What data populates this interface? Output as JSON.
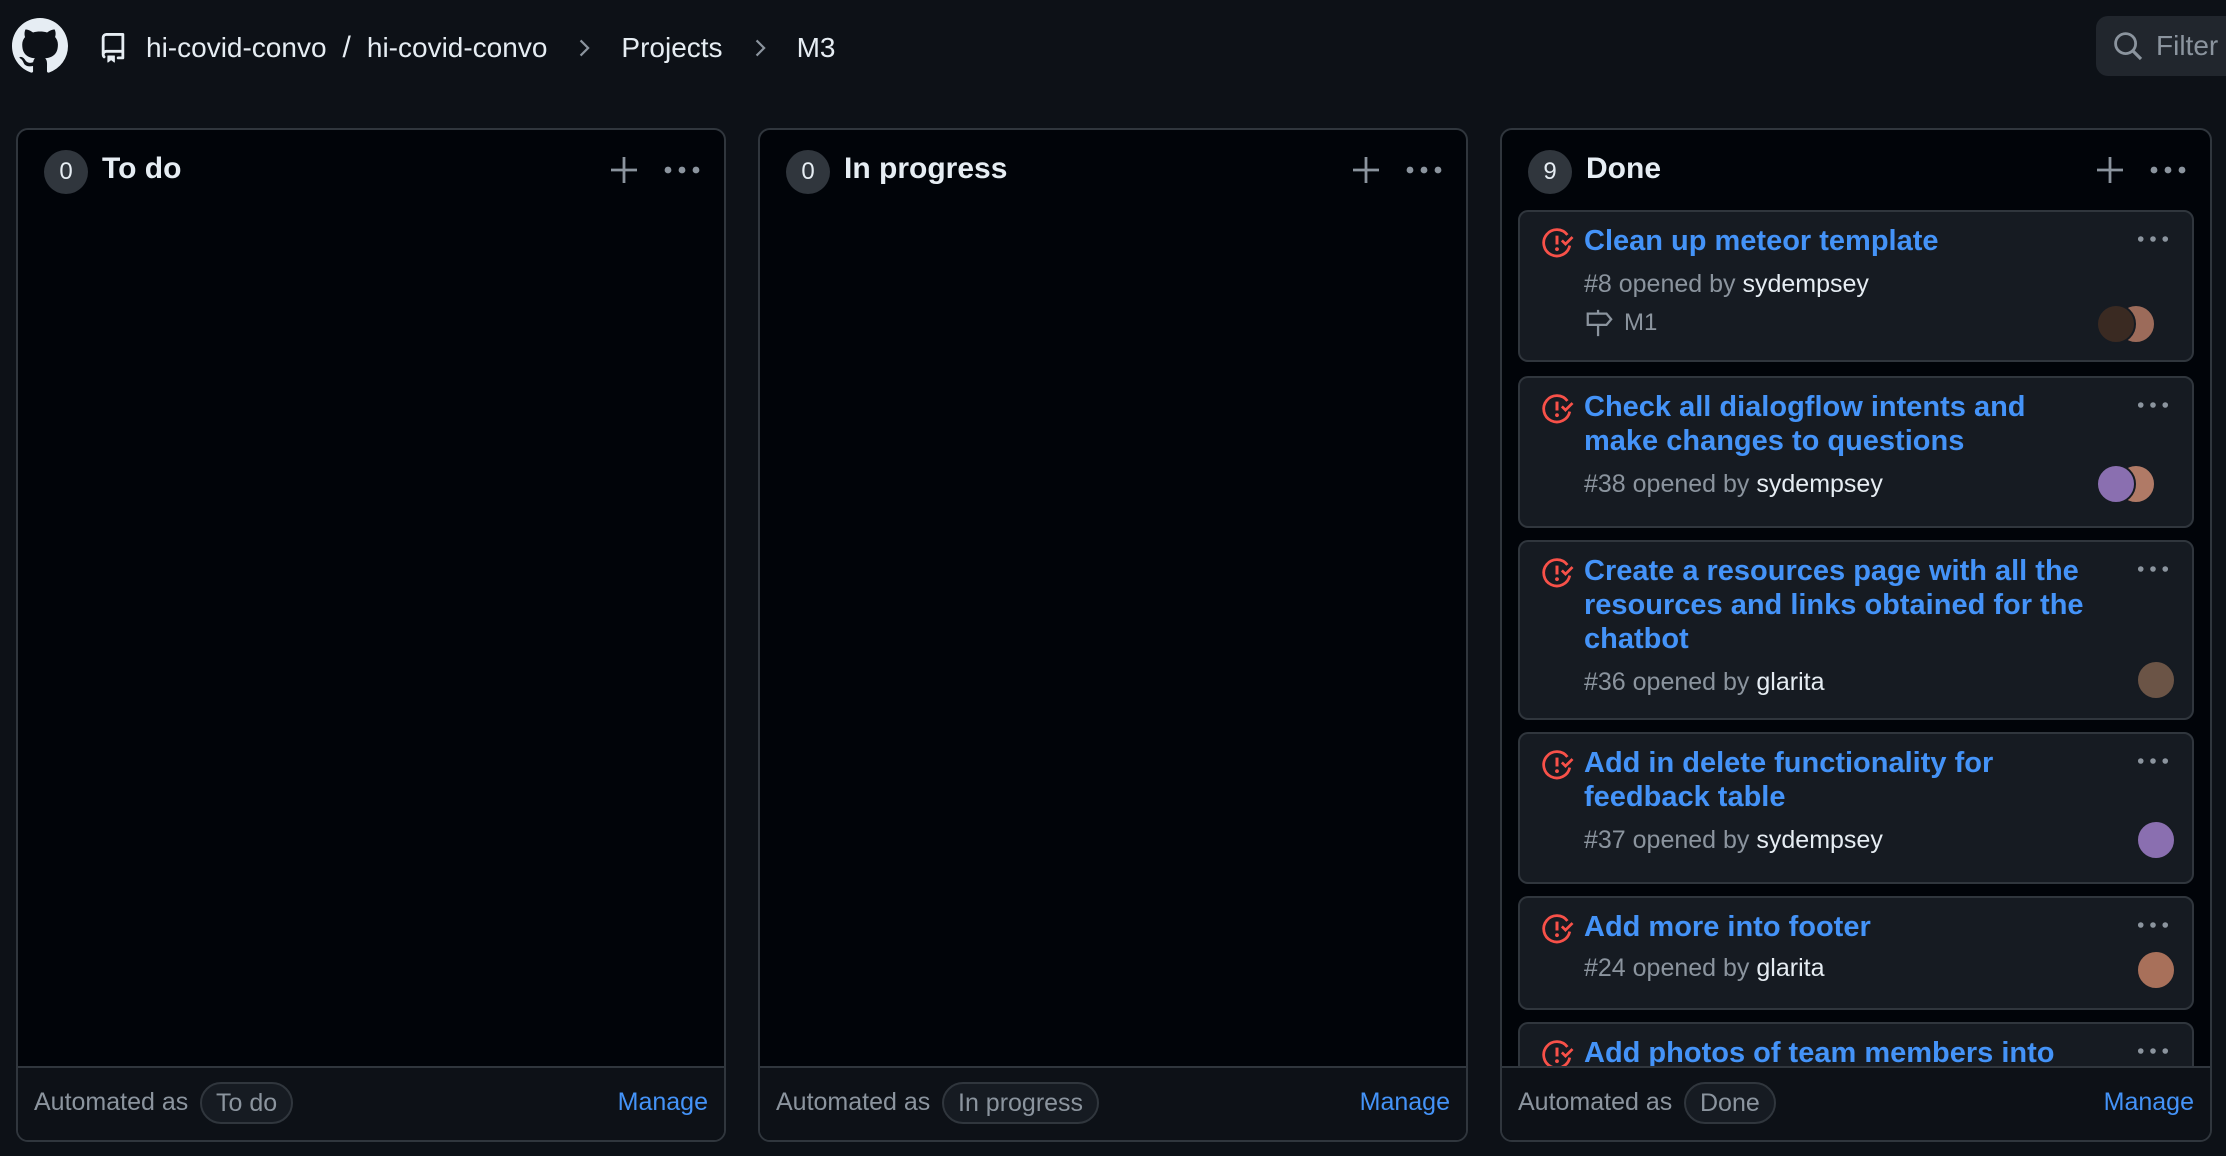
{
  "header": {
    "repo_owner": "hi-covid-convo",
    "separator": "/",
    "repo_name": "hi-covid-convo",
    "projects": "Projects",
    "project": "M3",
    "filter_placeholder": "Filter"
  },
  "columns": [
    {
      "count": "0",
      "title": "To do",
      "automated_label": "Automated as",
      "automated_value": "To do",
      "manage": "Manage"
    },
    {
      "count": "0",
      "title": "In progress",
      "automated_label": "Automated as",
      "automated_value": "In progress",
      "manage": "Manage"
    },
    {
      "count": "9",
      "title": "Done",
      "automated_label": "Automated as",
      "automated_value": "Done",
      "manage": "Manage",
      "cards": [
        {
          "title": "Clean up meteor template",
          "meta_prefix": "#8 opened by",
          "author": "sydempsey",
          "milestone": "M1"
        },
        {
          "title": "Check all dialogflow intents and make changes to questions",
          "meta_prefix": "#38 opened by",
          "author": "sydempsey"
        },
        {
          "title": "Create a resources page with all the resources and links obtained for the chatbot",
          "meta_prefix": "#36 opened by",
          "author": "glarita"
        },
        {
          "title": "Add in delete functionality for feedback table",
          "meta_prefix": "#37 opened by",
          "author": "sydempsey"
        },
        {
          "title": "Add more into footer",
          "meta_prefix": "#24 opened by",
          "author": "glarita"
        },
        {
          "title": "Add photos of team members into"
        }
      ]
    }
  ],
  "colors": {
    "background": "#0d1117",
    "column_bg": "#010409",
    "border": "#30363d",
    "link": "#4493f8",
    "closed_issue": "#f85149"
  }
}
